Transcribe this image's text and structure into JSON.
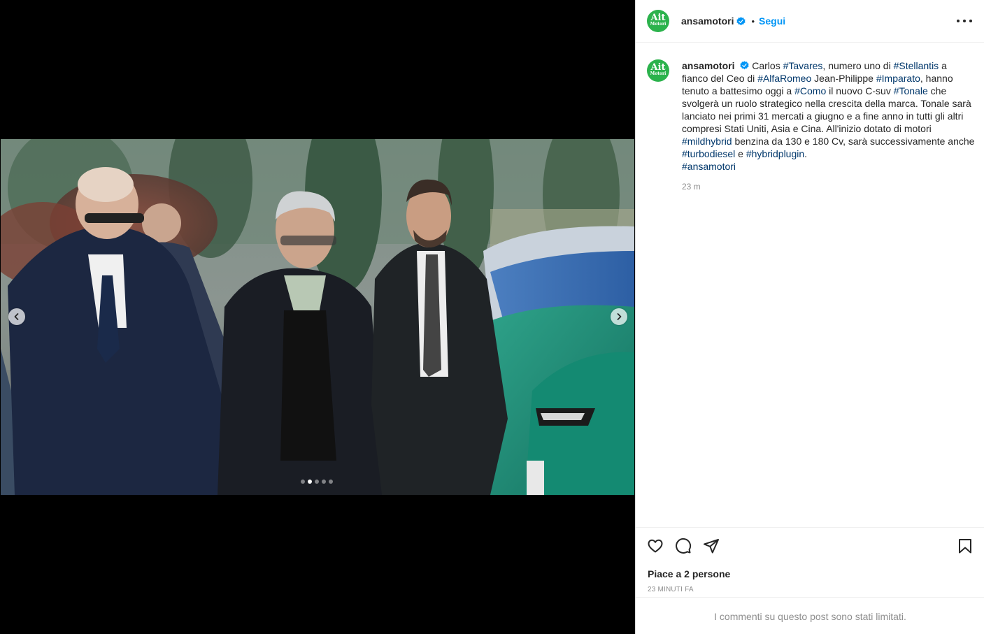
{
  "post": {
    "username": "ansamotori",
    "follow_label": "Segui",
    "bullet": "•",
    "avatar_line1": "Ait",
    "avatar_line2": "Motori",
    "caption": {
      "segments": [
        {
          "t": "Carlos "
        },
        {
          "t": "#Tavares",
          "tag": true
        },
        {
          "t": ", numero uno di "
        },
        {
          "t": "#Stellantis",
          "tag": true
        },
        {
          "t": " a fianco del Ceo di "
        },
        {
          "t": "#AlfaRomeo",
          "tag": true
        },
        {
          "t": " Jean-Philippe "
        },
        {
          "t": "#Imparato",
          "tag": true
        },
        {
          "t": ", hanno tenuto a battesimo oggi a "
        },
        {
          "t": "#Como",
          "tag": true
        },
        {
          "t": " il nuovo C-suv "
        },
        {
          "t": "#Tonale",
          "tag": true
        },
        {
          "t": " che svolgerà un ruolo strategico nella crescita della marca. Tonale sarà lanciato nei primi 31 mercati a giugno e a fine anno in tutti gli altri compresi Stati Uniti, Asia e Cina. All'inizio dotato di motori "
        },
        {
          "t": "#mildhybrid",
          "tag": true
        },
        {
          "t": " benzina da 130 e 180 Cv, sarà successivamente anche "
        },
        {
          "t": "#turbodiesel",
          "tag": true
        },
        {
          "t": " e "
        },
        {
          "t": "#hybridplugin",
          "tag": true
        },
        {
          "t": ".",
          "br": true
        },
        {
          "t": "#ansamotori",
          "tag": true
        }
      ]
    },
    "caption_time": "23 m",
    "likes_prefix": "Piace a ",
    "likes_count": "2 persone",
    "timestamp": "23 minuti fa",
    "comments_limited": "I commenti su questo post sono stati limitati."
  },
  "carousel": {
    "total_slides": 5,
    "active_index": 1
  },
  "icons": {
    "verified": "verified-badge-icon",
    "like": "heart-icon",
    "comment": "comment-icon",
    "share": "share-icon",
    "save": "bookmark-icon",
    "more": "more-options-icon",
    "prev": "chevron-left-icon",
    "next": "chevron-right-icon"
  },
  "colors": {
    "link": "#00376b",
    "follow": "#0095f6",
    "verified": "#0095f6",
    "avatar_bg": "#2bb24c"
  }
}
